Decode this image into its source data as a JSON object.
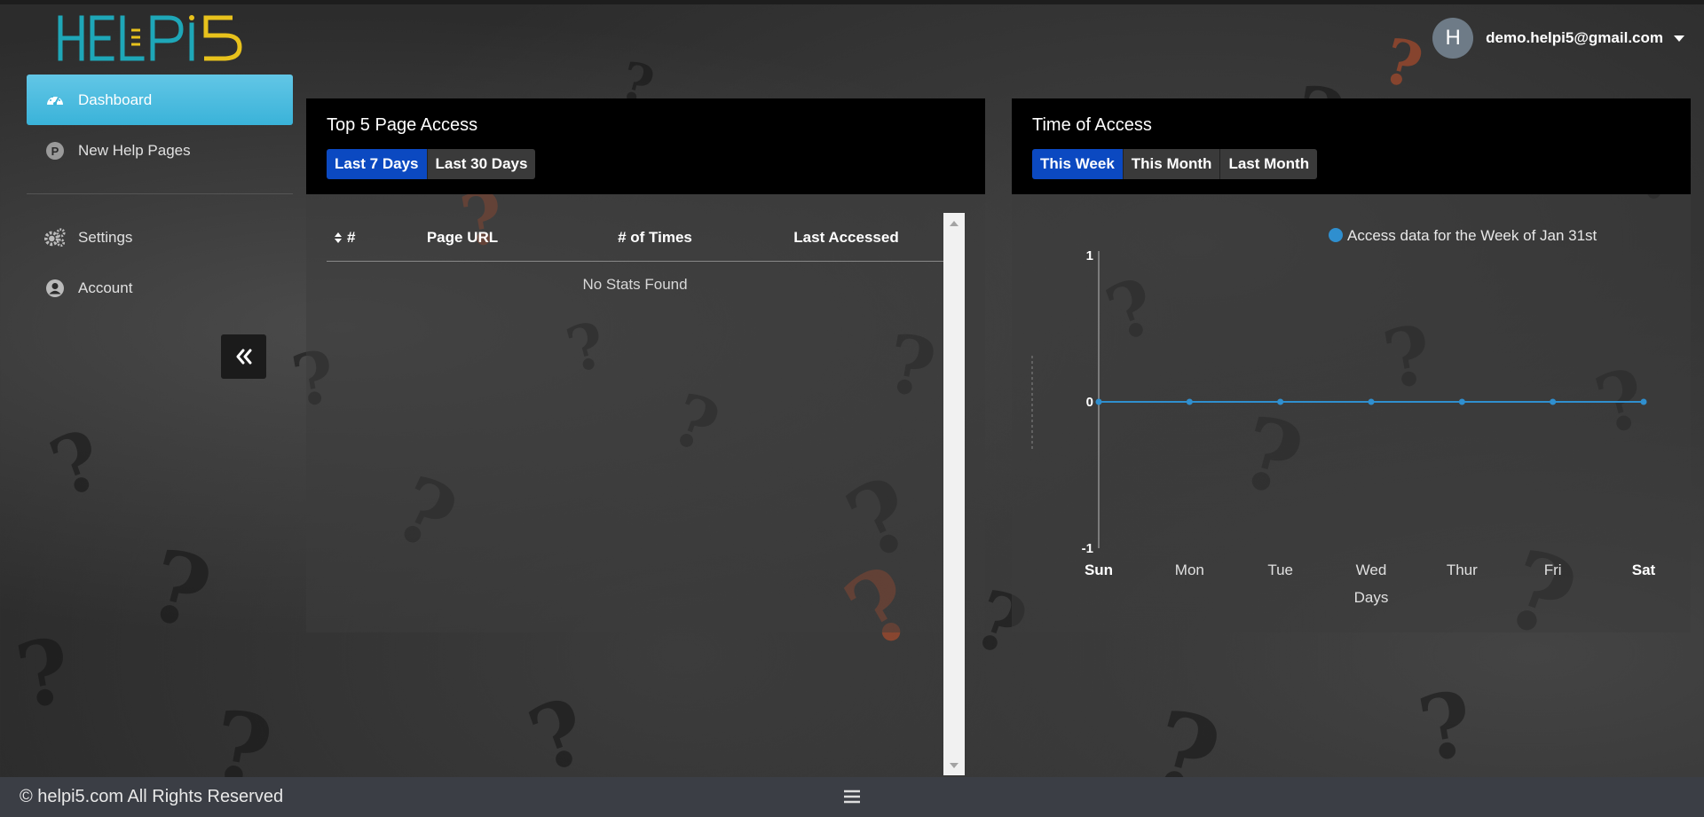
{
  "brand": {
    "logo_text": "HELPI5"
  },
  "user": {
    "avatar_initial": "H",
    "email": "demo.helpi5@gmail.com"
  },
  "sidebar": {
    "items": [
      {
        "label": "Dashboard",
        "icon": "dashboard-gauge-icon",
        "active": true
      },
      {
        "label": "New Help Pages",
        "icon": "p-circle-icon",
        "active": false
      },
      {
        "label": "Settings",
        "icon": "gears-icon",
        "active": false
      },
      {
        "label": "Account",
        "icon": "user-circle-icon",
        "active": false
      }
    ],
    "collapse_icon": "double-chevron-left-icon"
  },
  "top_pages": {
    "title": "Top 5 Page Access",
    "filters": [
      {
        "label": "Last 7 Days",
        "active": true
      },
      {
        "label": "Last 30 Days",
        "active": false
      }
    ],
    "columns": [
      "#",
      "Page URL",
      "# of Times",
      "Last Accessed"
    ],
    "empty_message": "No Stats Found"
  },
  "time_of_access": {
    "title": "Time of Access",
    "filters": [
      {
        "label": "This Week",
        "active": true
      },
      {
        "label": "This Month",
        "active": false
      },
      {
        "label": "Last Month",
        "active": false
      }
    ]
  },
  "chart_data": {
    "type": "line",
    "legend": "Access data for the Week of Jan 31st",
    "legend_position": "top-right",
    "categories": [
      "Sun",
      "Mon",
      "Tue",
      "Wed",
      "Thur",
      "Fri",
      "Sat"
    ],
    "bold_categories": [
      "Sun",
      "Sat"
    ],
    "series": [
      {
        "name": "Access data for the Week of Jan 31st",
        "values": [
          0,
          0,
          0,
          0,
          0,
          0,
          0
        ],
        "color": "#2f8fcf"
      }
    ],
    "yticks": [
      "1",
      "0",
      "-1"
    ],
    "ylim": [
      -1,
      1
    ],
    "xlabel": "Days",
    "ylabel": "",
    "grid": false
  },
  "footer": {
    "copyright": "© helpi5.com All Rights Reserved",
    "menu_icon": "hamburger-menu-icon"
  },
  "colors": {
    "accent": "#3ab3d9",
    "active_button": "#0b49c1",
    "line": "#2f8fcf",
    "logo_teal": "#1ea7b8",
    "logo_yellow": "#e8c21c"
  }
}
